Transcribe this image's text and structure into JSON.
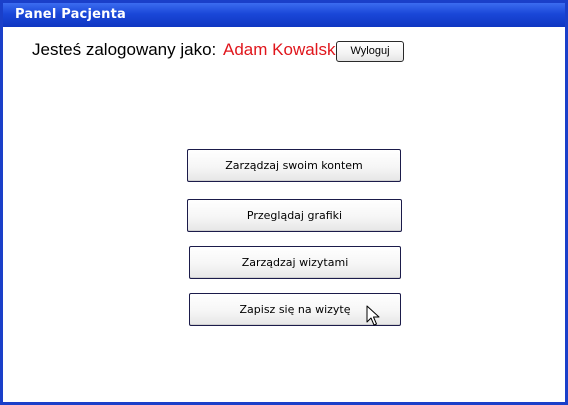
{
  "window": {
    "title": "Panel Pacjenta"
  },
  "header": {
    "logged_in_label": "Jesteś zalogowany jako:",
    "user_name": "Adam Kowalski",
    "logout_label": "Wyloguj"
  },
  "menu": {
    "items": [
      {
        "label": "Zarządzaj swoim kontem"
      },
      {
        "label": "Przeglądaj grafiki"
      },
      {
        "label": "Zarządzaj wizytami"
      },
      {
        "label": "Zapisz się na wizytę"
      }
    ]
  },
  "colors": {
    "titlebar": "#1a47d8",
    "border": "#1a3fc9",
    "user_name": "#e0161c"
  },
  "icons": {
    "pointer": "mouse-pointer-icon"
  }
}
